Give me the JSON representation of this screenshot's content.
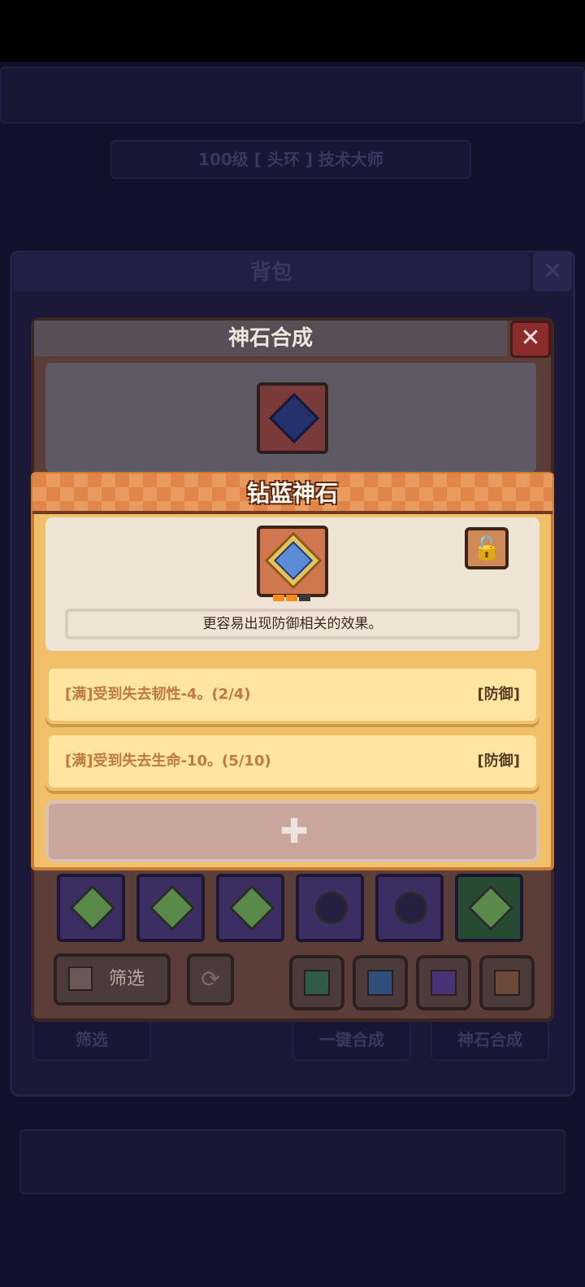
{
  "background": {
    "backpack_title": "背包",
    "backpack_close": "✕",
    "banner_text": "100级   [ 头环 ] 技术大师",
    "buttons": [
      "筛选",
      "一键合成",
      "神石合成"
    ]
  },
  "modal": {
    "title": "神石合成",
    "close": "✕"
  },
  "gem_card": {
    "title": "钻蓝神石",
    "lock_icon": "🔓",
    "description": "更容易出现防御相关的效果。",
    "effects": [
      {
        "text": "[满]受到失去韧性-4。(2/4)",
        "tag": "[防御]"
      },
      {
        "text": "[满]受到失去生命-10。(5/10)",
        "tag": "[防御]"
      }
    ],
    "add_icon": "✚"
  },
  "inventory": {
    "items": [
      {
        "icon": "green-square-gem-icon",
        "color": "#5a8a4a",
        "frame": "#3b2e63"
      },
      {
        "icon": "green-square-gem-icon",
        "color": "#5a8a4a",
        "frame": "#3b2e63"
      },
      {
        "icon": "green-square-gem-icon",
        "color": "#5a8a4a",
        "frame": "#3b2e63"
      },
      {
        "icon": "dark-round-gem-icon",
        "color": "#252040",
        "frame": "#3b2e63"
      },
      {
        "icon": "dark-round-gem-icon",
        "color": "#252040",
        "frame": "#3b2e63"
      },
      {
        "icon": "green-square-gem-icon",
        "color": "#5a8a4a",
        "frame": "#274a33"
      }
    ],
    "filter_label": "筛选",
    "refresh_icon": "⟳",
    "color_filters": [
      "#2f5a45",
      "#2f4f7a",
      "#4a3277",
      "#6b4a3a"
    ]
  },
  "colors": {
    "accent_orange": "#e08648",
    "card_yellow": "#ffe5a0",
    "tag_brown": "#5a3a22"
  }
}
